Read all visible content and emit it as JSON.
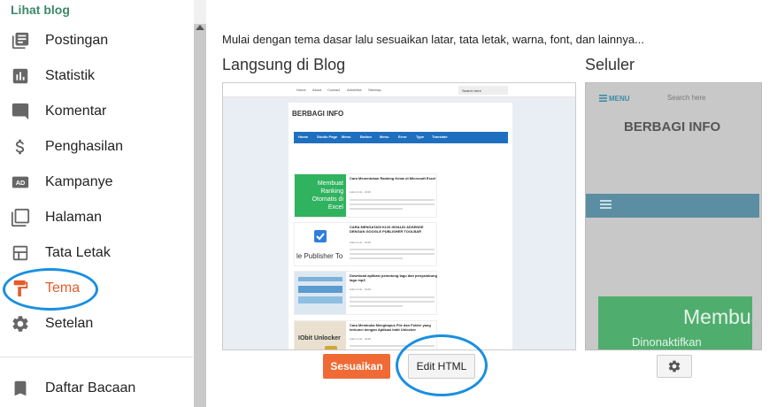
{
  "sidebar": {
    "view_blog": "Lihat blog",
    "items": [
      {
        "label": "Postingan",
        "icon": "posts-icon"
      },
      {
        "label": "Statistik",
        "icon": "stats-icon"
      },
      {
        "label": "Komentar",
        "icon": "comment-icon"
      },
      {
        "label": "Penghasilan",
        "icon": "dollar-icon"
      },
      {
        "label": "Kampanye",
        "icon": "ad-icon"
      },
      {
        "label": "Halaman",
        "icon": "pages-icon"
      },
      {
        "label": "Tata Letak",
        "icon": "layout-icon"
      },
      {
        "label": "Tema",
        "icon": "paint-roller-icon",
        "active": true
      },
      {
        "label": "Setelan",
        "icon": "gear-icon"
      }
    ],
    "reading_list": {
      "label": "Daftar Bacaan",
      "icon": "bookmark-icon"
    }
  },
  "main": {
    "intro": "Mulai dengan tema dasar lalu sesuaikan latar, tata letak, warna, font, dan lainnya...",
    "live_heading": "Langsung di Blog",
    "mobile_heading": "Seluler",
    "customize_button": "Sesuaikan",
    "edit_html_button": "Edit HTML"
  },
  "desktop_preview": {
    "top_links": [
      "Home",
      "About",
      "Contact",
      "Advertise",
      "Sitemap"
    ],
    "search_placeholder": "Search here",
    "blog_title": "BERBAGI INFO",
    "nav_items": [
      "Home",
      "Studio Page",
      "Menu",
      "Button",
      "Menu",
      "Error",
      "Type",
      "Translate"
    ],
    "posts": [
      {
        "title": "Cara Menentukan Ranking Kelas di Microsoft Excel",
        "thumb": "Membuat Ranking Otomatis di Excel",
        "meta": "Admin Info · 2018"
      },
      {
        "title": "CARA MENGATASI KLIK INVALID ADSENSE DENGAN GOOGLE PUBLISHER TOOLBAR",
        "thumb": "le Publisher To",
        "meta": "Admin Info · 2018"
      },
      {
        "title": "Download aplikasi pemotong lagu dan penyambung lagu mp3",
        "thumb": "",
        "meta": "Admin Info · 2018"
      },
      {
        "title": "Cara Membuka Menghapus File dan Folder yang terkunci dengan Aplikasi Iobit Unlocker",
        "thumb": "IObit Unlocker",
        "meta": "Admin Info · 2018"
      }
    ]
  },
  "mobile_preview": {
    "menu_label": "MENU",
    "search_placeholder": "Search here",
    "blog_title": "BERBAGI INFO",
    "green_text_1": "Membuat",
    "green_text_2": "Dinonaktifkan"
  },
  "colors": {
    "accent_green": "#3d8a69",
    "active_orange": "#e55a2b",
    "customize_button": "#f06a35",
    "annotation_blue": "#1a8fe0"
  }
}
